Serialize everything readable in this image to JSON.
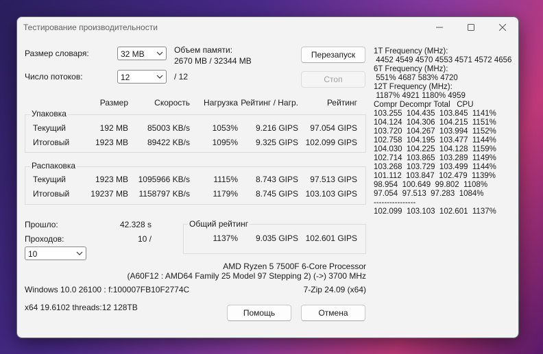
{
  "window": {
    "title": "Тестирование производительности"
  },
  "dict": {
    "label": "Размер словаря:",
    "value": "32 MB"
  },
  "threads": {
    "label": "Число потоков:",
    "value": "12",
    "max": "/ 12"
  },
  "memory": {
    "label": "Объем памяти:",
    "value": "2670 MB / 32344 MB"
  },
  "buttons": {
    "restart": "Перезапуск",
    "stop": "Стоп",
    "help": "Помощь",
    "cancel": "Отмена"
  },
  "headers": {
    "size": "Размер",
    "speed": "Скорость",
    "load": "Нагрузка",
    "rating_load": "Рейтинг / Нагр.",
    "rating": "Рейтинг"
  },
  "compress": {
    "label": "Упаковка",
    "current": {
      "name": "Текущий",
      "size": "192 MB",
      "speed": "85003 KB/s",
      "load": "1053%",
      "rl": "9.216 GIPS",
      "rating": "97.054 GIPS"
    },
    "total": {
      "name": "Итоговый",
      "size": "1923 MB",
      "speed": "89422 KB/s",
      "load": "1095%",
      "rl": "9.325 GIPS",
      "rating": "102.099 GIPS"
    }
  },
  "decompress": {
    "label": "Распаковка",
    "current": {
      "name": "Текущий",
      "size": "1923 MB",
      "speed": "1095966 KB/s",
      "load": "1115%",
      "rl": "8.743 GIPS",
      "rating": "97.513 GIPS"
    },
    "total": {
      "name": "Итоговый",
      "size": "19237 MB",
      "speed": "1158797 KB/s",
      "load": "1179%",
      "rl": "8.745 GIPS",
      "rating": "103.103 GIPS"
    }
  },
  "elapsed": {
    "label": "Прошло:",
    "value": "42.328 s"
  },
  "passes": {
    "label": "Проходов:",
    "value": "10 /",
    "select": "10"
  },
  "overall": {
    "label": "Общий рейтинг",
    "load": "1137%",
    "rl": "9.035 GIPS",
    "rating": "102.601 GIPS"
  },
  "cpu": {
    "line1": "AMD Ryzen 5 7500F 6-Core Processor",
    "line2": "(A60F12 : AMD64 Family 25 Model 97 Stepping 2) (->) 3700 MHz"
  },
  "os": "Windows 10.0 26100 :  f:100007FB10F2774C",
  "version": "7-Zip 24.09 (x64)",
  "build": "x64 19.6102 threads:12 128TB",
  "freq_lines": [
    "1T Frequency (MHz):",
    " 4452 4549 4570 4553 4571 4572 4656",
    "6T Frequency (MHz):",
    " 551% 4687 583% 4720",
    "12T Frequency (MHz):",
    " 1187% 4921 1180% 4959",
    "Compr Decompr Total   CPU",
    "103.255  104.435  103.845  1141%",
    "104.124  104.306  104.215  1151%",
    "103.720  104.267  103.994  1152%",
    "102.758  104.195  103.477  1144%",
    "104.030  104.225  104.128  1159%",
    "102.714  103.865  103.289  1149%",
    "103.268  103.729  103.499  1144%",
    "101.112  103.847  102.479  1139%",
    "98.954  100.649  99.802  1108%",
    "97.054  97.513  97.283  1084%",
    "----------------",
    "102.099  103.103  102.601  1137%"
  ]
}
